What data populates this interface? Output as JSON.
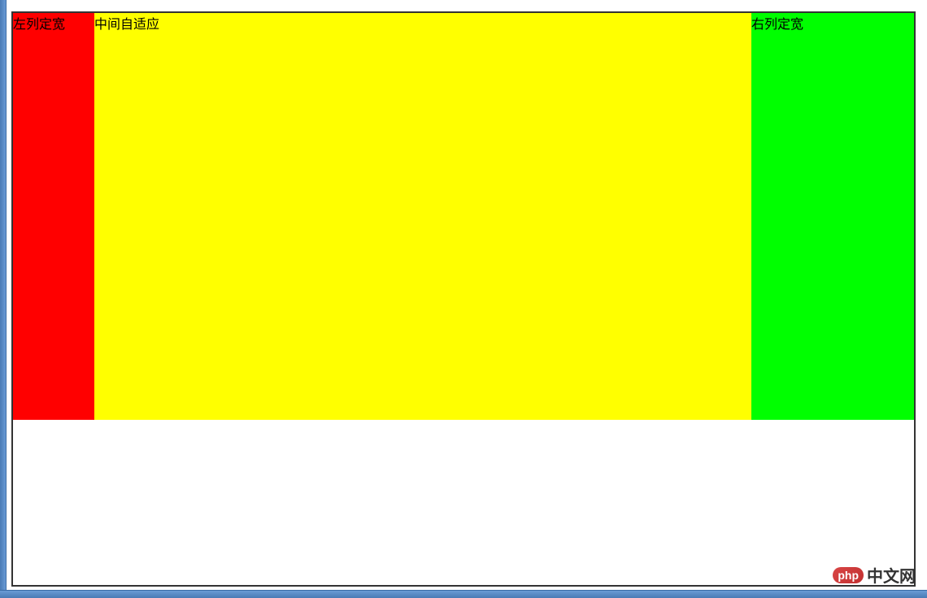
{
  "layout": {
    "left": {
      "label": "左列定宽"
    },
    "center": {
      "label": "中间自适应"
    },
    "right": {
      "label": "右列定宽"
    }
  },
  "watermark": {
    "logo": "php",
    "text": "中文网"
  }
}
